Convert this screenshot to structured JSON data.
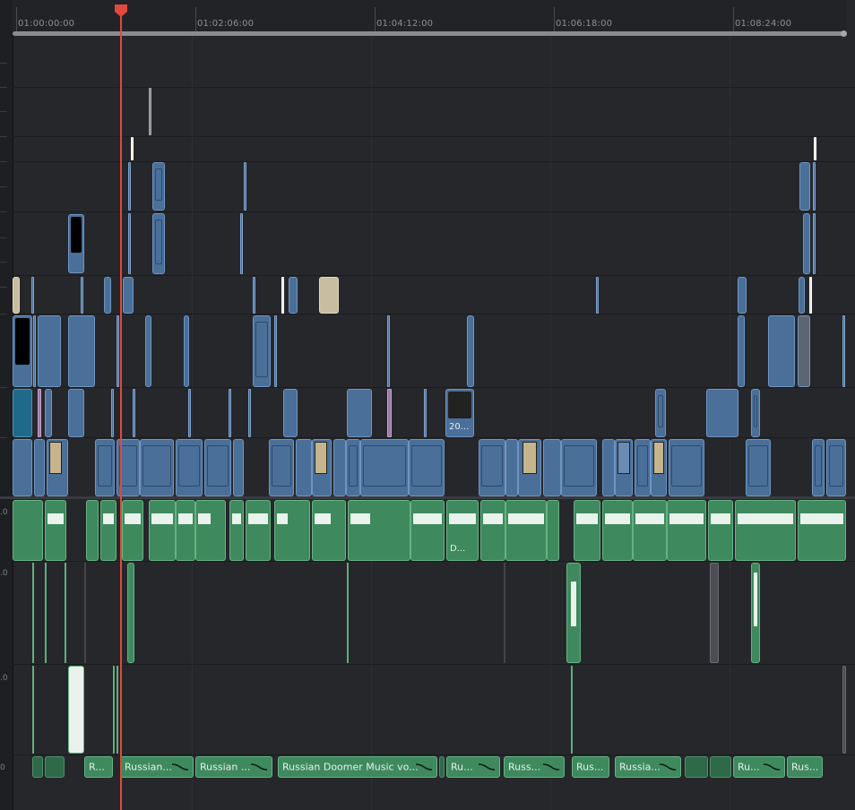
{
  "timeline": {
    "timecodes": [
      "01:00:00:00",
      "01:02:06:00",
      "01:04:12:00",
      "01:06:18:00",
      "01:08:24:00"
    ],
    "track_header_labels": [
      ".0",
      ".0",
      ".0",
      "0"
    ],
    "clip_labels": {
      "v1_clip": "20...",
      "a1_clip": "D...",
      "a4_1": "R...",
      "a4_2": "Russian...",
      "a4_3": "Russian ...",
      "a4_4": "Russian Doomer Music vo...",
      "a4_5": "Ru...",
      "a4_6": "Russ...",
      "a4_7": "Rus...",
      "a4_8": "Russia...",
      "a4_9": "Ru...",
      "a4_10": "Rus..."
    },
    "colors": {
      "video_clip": "#4a6f99",
      "audio_clip": "#3e8a5e",
      "playhead": "#e2483d",
      "background": "#26272b"
    }
  }
}
